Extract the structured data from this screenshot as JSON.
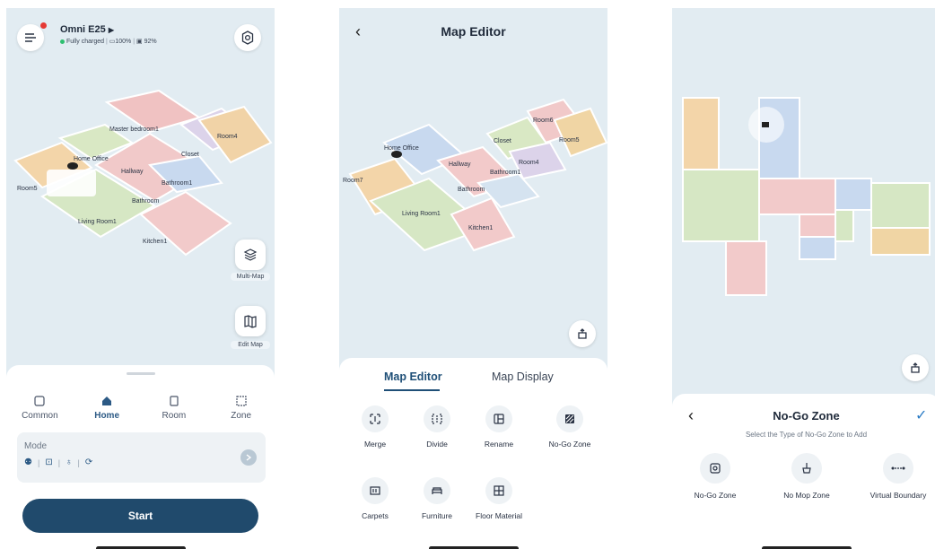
{
  "home_screen": {
    "device_name": "Omni E25",
    "status": "Fully charged",
    "battery": "100%",
    "dock": "92%",
    "rooms": [
      "Master bedroom1",
      "Room4",
      "Home Office",
      "Closet",
      "Hallway",
      "Room5",
      "Bathroom1",
      "Bathroom",
      "Living Room1",
      "Kitchen1"
    ],
    "multi_map_label": "Multi-Map",
    "edit_map_label": "Edit Map",
    "tabs": [
      {
        "label": "Common",
        "icon": "common-icon"
      },
      {
        "label": "Home",
        "icon": "home-icon"
      },
      {
        "label": "Room",
        "icon": "room-icon"
      },
      {
        "label": "Zone",
        "icon": "zone-icon"
      }
    ],
    "active_tab": "Home",
    "mode_label": "Mode",
    "start_label": "Start"
  },
  "map_editor_screen": {
    "title": "Map Editor",
    "rooms": [
      "Room6",
      "Room5",
      "Closet",
      "Home Office",
      "Room4",
      "Hallway",
      "Bathroom1",
      "Room7",
      "Bathroom",
      "Living Room1",
      "Kitchen1"
    ],
    "tabs": [
      "Map Editor",
      "Map Display"
    ],
    "tools": [
      "Merge",
      "Divide",
      "Rename",
      "No-Go Zone",
      "Carpets",
      "Furniture",
      "Floor Material"
    ]
  },
  "nogo_screen": {
    "title": "No-Go Zone",
    "subtitle": "Select the Type of No-Go Zone to Add",
    "options": [
      "No-Go Zone",
      "No Mop Zone",
      "Virtual Boundary"
    ]
  },
  "colors": {
    "accent": "#204a6c",
    "map_background": "#e2ecf2",
    "sheet": "#ffffff"
  }
}
